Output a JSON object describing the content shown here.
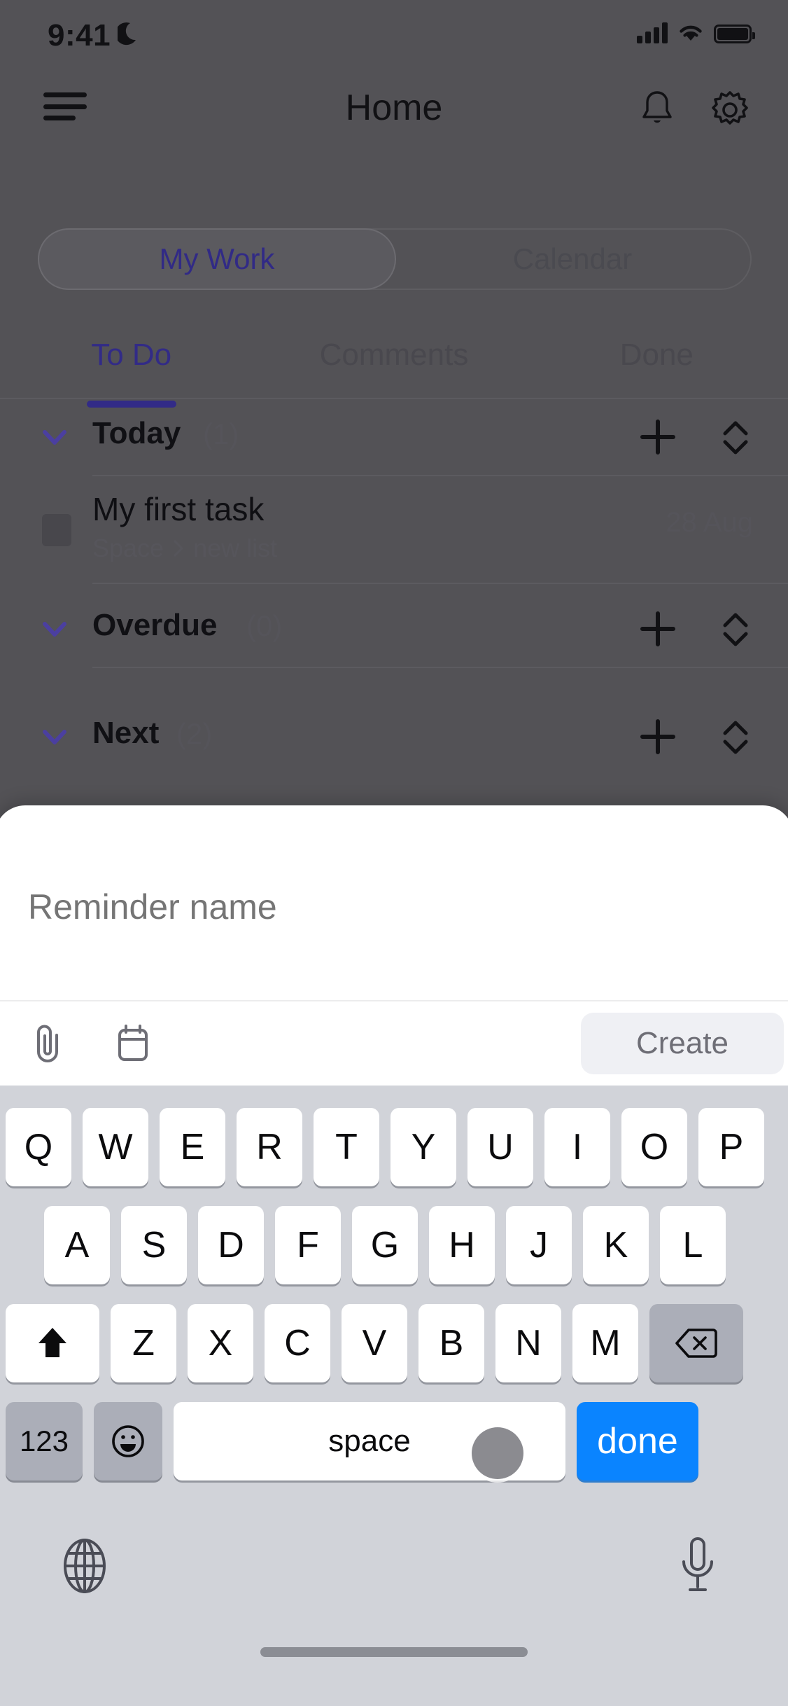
{
  "status_bar": {
    "time": "9:41",
    "dnd_icon": "moon-icon",
    "signal_icon": "cellular-signal-icon",
    "wifi_icon": "wifi-icon",
    "battery_icon": "battery-icon"
  },
  "header": {
    "menu_icon": "hamburger-menu-icon",
    "title": "Home",
    "notification_icon": "bell-icon",
    "settings_icon": "gear-icon"
  },
  "segmented_control": {
    "items": [
      {
        "label": "My Work",
        "active": true
      },
      {
        "label": "Calendar",
        "active": false
      }
    ],
    "active_color": "#322b87"
  },
  "tabs": [
    {
      "label": "To Do",
      "active": true
    },
    {
      "label": "Comments",
      "active": false
    },
    {
      "label": "Done",
      "active": false
    }
  ],
  "sections": [
    {
      "title": "Today",
      "count": "(1)",
      "chevron_icon": "chevron-down-icon",
      "add_icon": "plus-icon",
      "sort_icon": "sort-updown-icon"
    },
    {
      "title": "Overdue",
      "count": "(0)",
      "chevron_icon": "chevron-down-icon",
      "add_icon": "plus-icon",
      "sort_icon": "sort-updown-icon"
    },
    {
      "title": "Next",
      "count": "(2)",
      "chevron_icon": "chevron-down-icon",
      "add_icon": "plus-icon",
      "sort_icon": "sort-updown-icon"
    }
  ],
  "task": {
    "title": "My first task",
    "breadcrumb_space": "Space",
    "breadcrumb_list": "new list",
    "date": "28 Aug",
    "checkbox_icon": "checkbox-icon"
  },
  "sheet": {
    "input_placeholder": "Reminder name",
    "input_value": "",
    "attachment_icon": "paperclip-icon",
    "date_icon": "calendar-icon",
    "create_label": "Create"
  },
  "keyboard": {
    "row1": [
      "Q",
      "W",
      "E",
      "R",
      "T",
      "Y",
      "U",
      "I",
      "O",
      "P"
    ],
    "row2": [
      "A",
      "S",
      "D",
      "F",
      "G",
      "H",
      "J",
      "K",
      "L"
    ],
    "row3": [
      "Z",
      "X",
      "C",
      "V",
      "B",
      "N",
      "M"
    ],
    "shift_icon": "shift-arrow-icon",
    "backspace_icon": "backspace-icon",
    "numeric_label": "123",
    "emoji_icon": "emoji-smiley-icon",
    "space_label": "space",
    "return_label": "done",
    "globe_icon": "globe-icon",
    "mic_icon": "microphone-icon",
    "return_color": "#0a84ff"
  },
  "cursor": {
    "icon": "touch-cursor-indicator"
  }
}
